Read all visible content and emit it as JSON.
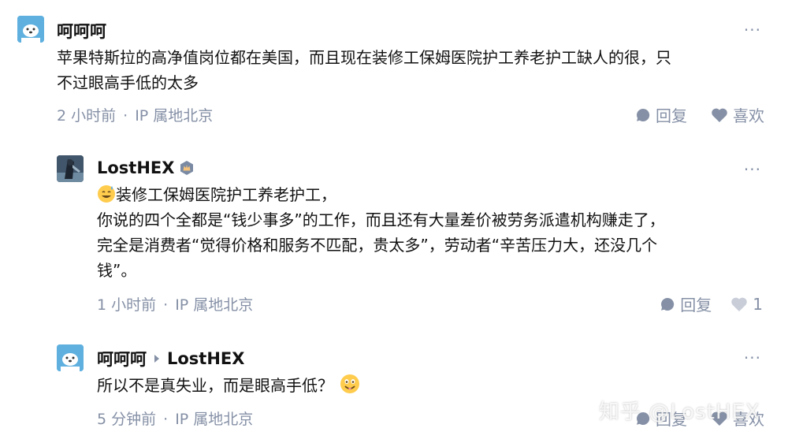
{
  "comments": [
    {
      "author": "呵呵呵",
      "lines": [
        "苹果特斯拉的高净值岗位都在美国，而且现在装修工保姆医院护工养老护工缺人的很，只",
        "不过眼高手低的太多"
      ],
      "time": "2 小时前",
      "dot": "·",
      "ip": "IP 属地北京",
      "reply_label": "回复",
      "like_label": "喜欢",
      "more": "···"
    },
    {
      "author": "LostHEX",
      "lines": [
        "装修工保姆医院护工养老护工，",
        "你说的四个全都是“钱少事多”的工作，而且还有大量差价被劳务派遣机构赚走了，",
        "完全是消费者“觉得价格和服务不匹配，贵太多”，劳动者“辛苦压力大，还没几个",
        "钱”。"
      ],
      "time": "1 小时前",
      "dot": "·",
      "ip": "IP 属地北京",
      "reply_label": "回复",
      "like_count": "1",
      "more": "···"
    },
    {
      "author": "呵呵呵",
      "reply_to": "LostHEX",
      "lines": [
        "所以不是真失业，而是眼高手低？"
      ],
      "time": "5 分钟前",
      "dot": "·",
      "ip": "IP 属地北京",
      "reply_label": "回复",
      "like_label": "喜欢",
      "more": "···"
    }
  ],
  "watermark": "知乎 @LostHEX",
  "colors": {
    "text": "#121212",
    "meta": "#8590a6",
    "avatar_bg": "#5fb0df"
  }
}
